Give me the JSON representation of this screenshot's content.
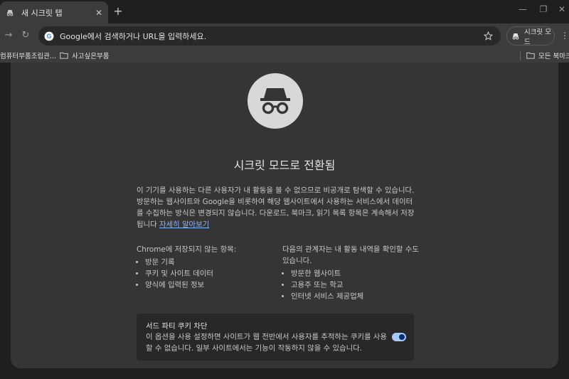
{
  "tab": {
    "title": "새 시크릿 탭",
    "close": "✕"
  },
  "window_controls": {
    "minimize": "—",
    "restore": "❐",
    "close": "✕"
  },
  "new_tab": "+",
  "toolbar": {
    "back": "←",
    "forward": "→",
    "reload": "↻",
    "omnibox_placeholder": "Google에서 검색하거나 URL을 입력하세요.",
    "incognito_label": "시크릿 모드",
    "menu": "⋮"
  },
  "bookmarks": {
    "items": [
      "컴퓨터부품조립관...",
      "사고싶은부품"
    ],
    "all_bookmarks": "모든 북마크"
  },
  "page": {
    "heading": "시크릿 모드로 전환됨",
    "intro_text": "이 기기를 사용하는 다른 사용자가 내 활동을 볼 수 없으므로 비공개로 탐색할 수 있습니다. 방문하는 웹사이트와 Google을 비롯하여 해당 웹사이트에서 사용하는 서비스에서 데이터를 수집하는 방식은 변경되지 않습니다. 다운로드, 북마크, 읽기 목록 항목은 계속해서 저장됩니다 ",
    "learn_more": "자세히 알아보기",
    "not_saved": {
      "heading": "Chrome에 저장되지 않는 항목:",
      "items": [
        "방문 기록",
        "쿠키 및 사이트 데이터",
        "양식에 입력된 정보"
      ]
    },
    "may_see": {
      "heading": "다음의 관계자는 내 활동 내역을 확인할 수도 있습니다.",
      "items": [
        "방문한 웹사이트",
        "고용주 또는 학교",
        "인터넷 서비스 제공업체"
      ]
    },
    "cookie": {
      "title": "서드 파티 쿠키 차단",
      "description": "이 옵션을 사용 설정하면 사이트가 웹 전반에서 사용자를 추적하는 쿠키를 사용할 수 없습니다. 일부 사이트에서는 기능이 작동하지 않을 수 있습니다.",
      "enabled": true
    }
  },
  "colors": {
    "background": "#1f1f1f",
    "toolbar": "#3c3c3c",
    "content": "#353535",
    "link": "#8ab4f8",
    "toggle_on": "#a8c7fa"
  }
}
